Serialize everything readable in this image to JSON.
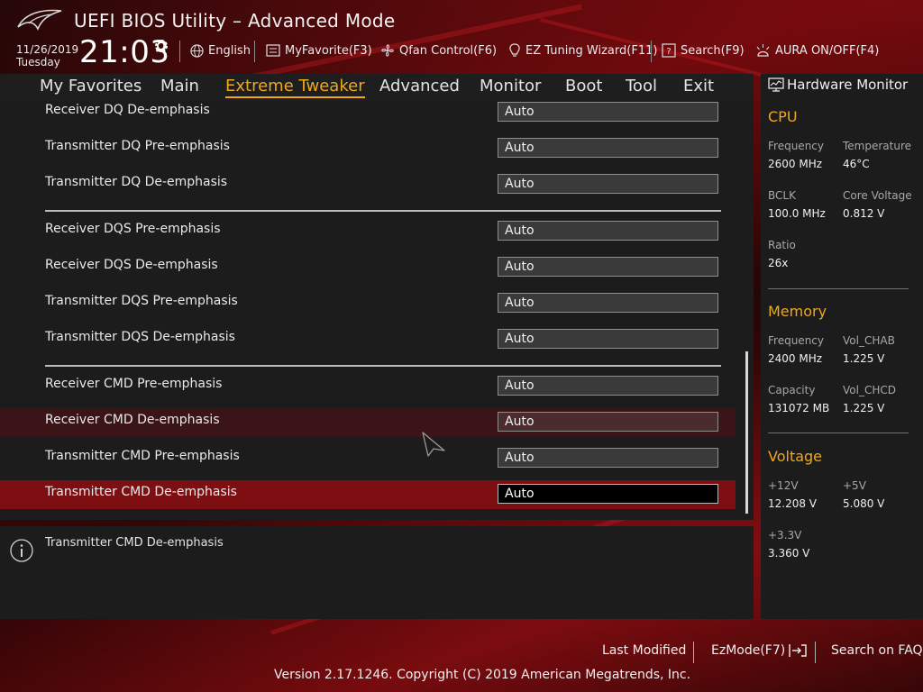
{
  "header": {
    "title": "UEFI BIOS Utility – Advanced Mode",
    "date": "11/26/2019",
    "day": "Tuesday",
    "time": "21:03"
  },
  "toolbar": {
    "language": "English",
    "myfavorite": "MyFavorite(F3)",
    "qfan": "Qfan Control(F6)",
    "ez_tuning": "EZ Tuning Wizard(F11)",
    "search": "Search(F9)",
    "aura": "AURA ON/OFF(F4)"
  },
  "menu": {
    "tabs": [
      {
        "label": "My Favorites"
      },
      {
        "label": "Main"
      },
      {
        "label": "Extreme Tweaker"
      },
      {
        "label": "Advanced"
      },
      {
        "label": "Monitor"
      },
      {
        "label": "Boot"
      },
      {
        "label": "Tool"
      },
      {
        "label": "Exit"
      }
    ],
    "active": "Extreme Tweaker"
  },
  "settings": [
    {
      "label": "Receiver DQ De-emphasis",
      "value": "Auto"
    },
    {
      "label": "Transmitter DQ Pre-emphasis",
      "value": "Auto"
    },
    {
      "label": "Transmitter DQ De-emphasis",
      "value": "Auto"
    },
    {
      "label": "Receiver DQS Pre-emphasis",
      "value": "Auto"
    },
    {
      "label": "Receiver DQS De-emphasis",
      "value": "Auto"
    },
    {
      "label": "Transmitter DQS Pre-emphasis",
      "value": "Auto"
    },
    {
      "label": "Transmitter DQS De-emphasis",
      "value": "Auto"
    },
    {
      "label": "Receiver CMD Pre-emphasis",
      "value": "Auto"
    },
    {
      "label": "Receiver CMD De-emphasis",
      "value": "Auto"
    },
    {
      "label": "Transmitter CMD Pre-emphasis",
      "value": "Auto"
    },
    {
      "label": "Transmitter CMD De-emphasis",
      "value": "Auto"
    }
  ],
  "help": {
    "text": "Transmitter CMD De-emphasis"
  },
  "hardware_monitor": {
    "title": "Hardware Monitor",
    "cpu": {
      "heading": "CPU",
      "frequency_label": "Frequency",
      "frequency": "2600 MHz",
      "temperature_label": "Temperature",
      "temperature": "46°C",
      "bclk_label": "BCLK",
      "bclk": "100.0 MHz",
      "core_voltage_label": "Core Voltage",
      "core_voltage": "0.812 V",
      "ratio_label": "Ratio",
      "ratio": "26x"
    },
    "memory": {
      "heading": "Memory",
      "frequency_label": "Frequency",
      "frequency": "2400 MHz",
      "vol_chab_label": "Vol_CHAB",
      "vol_chab": "1.225 V",
      "capacity_label": "Capacity",
      "capacity": "131072 MB",
      "vol_chcd_label": "Vol_CHCD",
      "vol_chcd": "1.225 V"
    },
    "voltage": {
      "heading": "Voltage",
      "v12_label": "+12V",
      "v12": "12.208 V",
      "v5_label": "+5V",
      "v5": "5.080 V",
      "v33_label": "+3.3V",
      "v33": "3.360 V"
    }
  },
  "footer": {
    "last_modified": "Last Modified",
    "ezmode": "EzMode(F7)",
    "search_faq": "Search on FAQ",
    "version": "Version 2.17.1246. Copyright (C) 2019 American Megatrends, Inc."
  },
  "colors": {
    "accent": "#f0a81a",
    "selected_row": "#7d0f12",
    "panel": "#1c1c1c"
  }
}
